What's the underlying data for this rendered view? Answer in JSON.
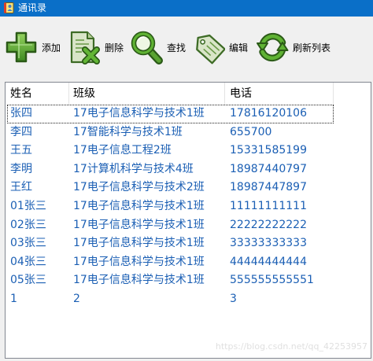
{
  "window": {
    "title": "通讯录",
    "title_bar_color": "#0a6fc8",
    "icon": "address-book-icon"
  },
  "toolbar": {
    "icon_color": "#5aa332",
    "buttons": [
      {
        "label": "添加",
        "icon": "add-plus-icon"
      },
      {
        "label": "删除",
        "icon": "delete-document-icon"
      },
      {
        "label": "查找",
        "icon": "search-magnifier-icon"
      },
      {
        "label": "编辑",
        "icon": "edit-tag-icon"
      },
      {
        "label": "刷新列表",
        "icon": "refresh-icon"
      }
    ]
  },
  "listview": {
    "columns": [
      "姓名",
      "班级",
      "电话"
    ],
    "text_color": "#1b5fb4",
    "focused_row": 0,
    "rows": [
      [
        "张四",
        "17电子信息科学与技术1班",
        "17816120106"
      ],
      [
        "李四",
        "17智能科学与技术1班",
        "655700"
      ],
      [
        "王五",
        "17电子信息工程2班",
        "15331585199"
      ],
      [
        "李明",
        "17计算机科学与技术4班",
        "18987440797"
      ],
      [
        "王红",
        "17电子信息科学与技术2班",
        "18987447897"
      ],
      [
        "01张三",
        "17电子信息科学与技术1班",
        "11111111111"
      ],
      [
        "02张三",
        "17电子信息科学与技术1班",
        "22222222222"
      ],
      [
        "03张三",
        "17电子信息科学与技术1班",
        "33333333333"
      ],
      [
        "04张三",
        "17电子信息科学与技术1班",
        "44444444444"
      ],
      [
        "05张三",
        "17电子信息科学与技术1班",
        "555555555551"
      ],
      [
        "1",
        "2",
        "3"
      ]
    ]
  },
  "watermark": "https://blog.csdn.net/qq_42253957"
}
